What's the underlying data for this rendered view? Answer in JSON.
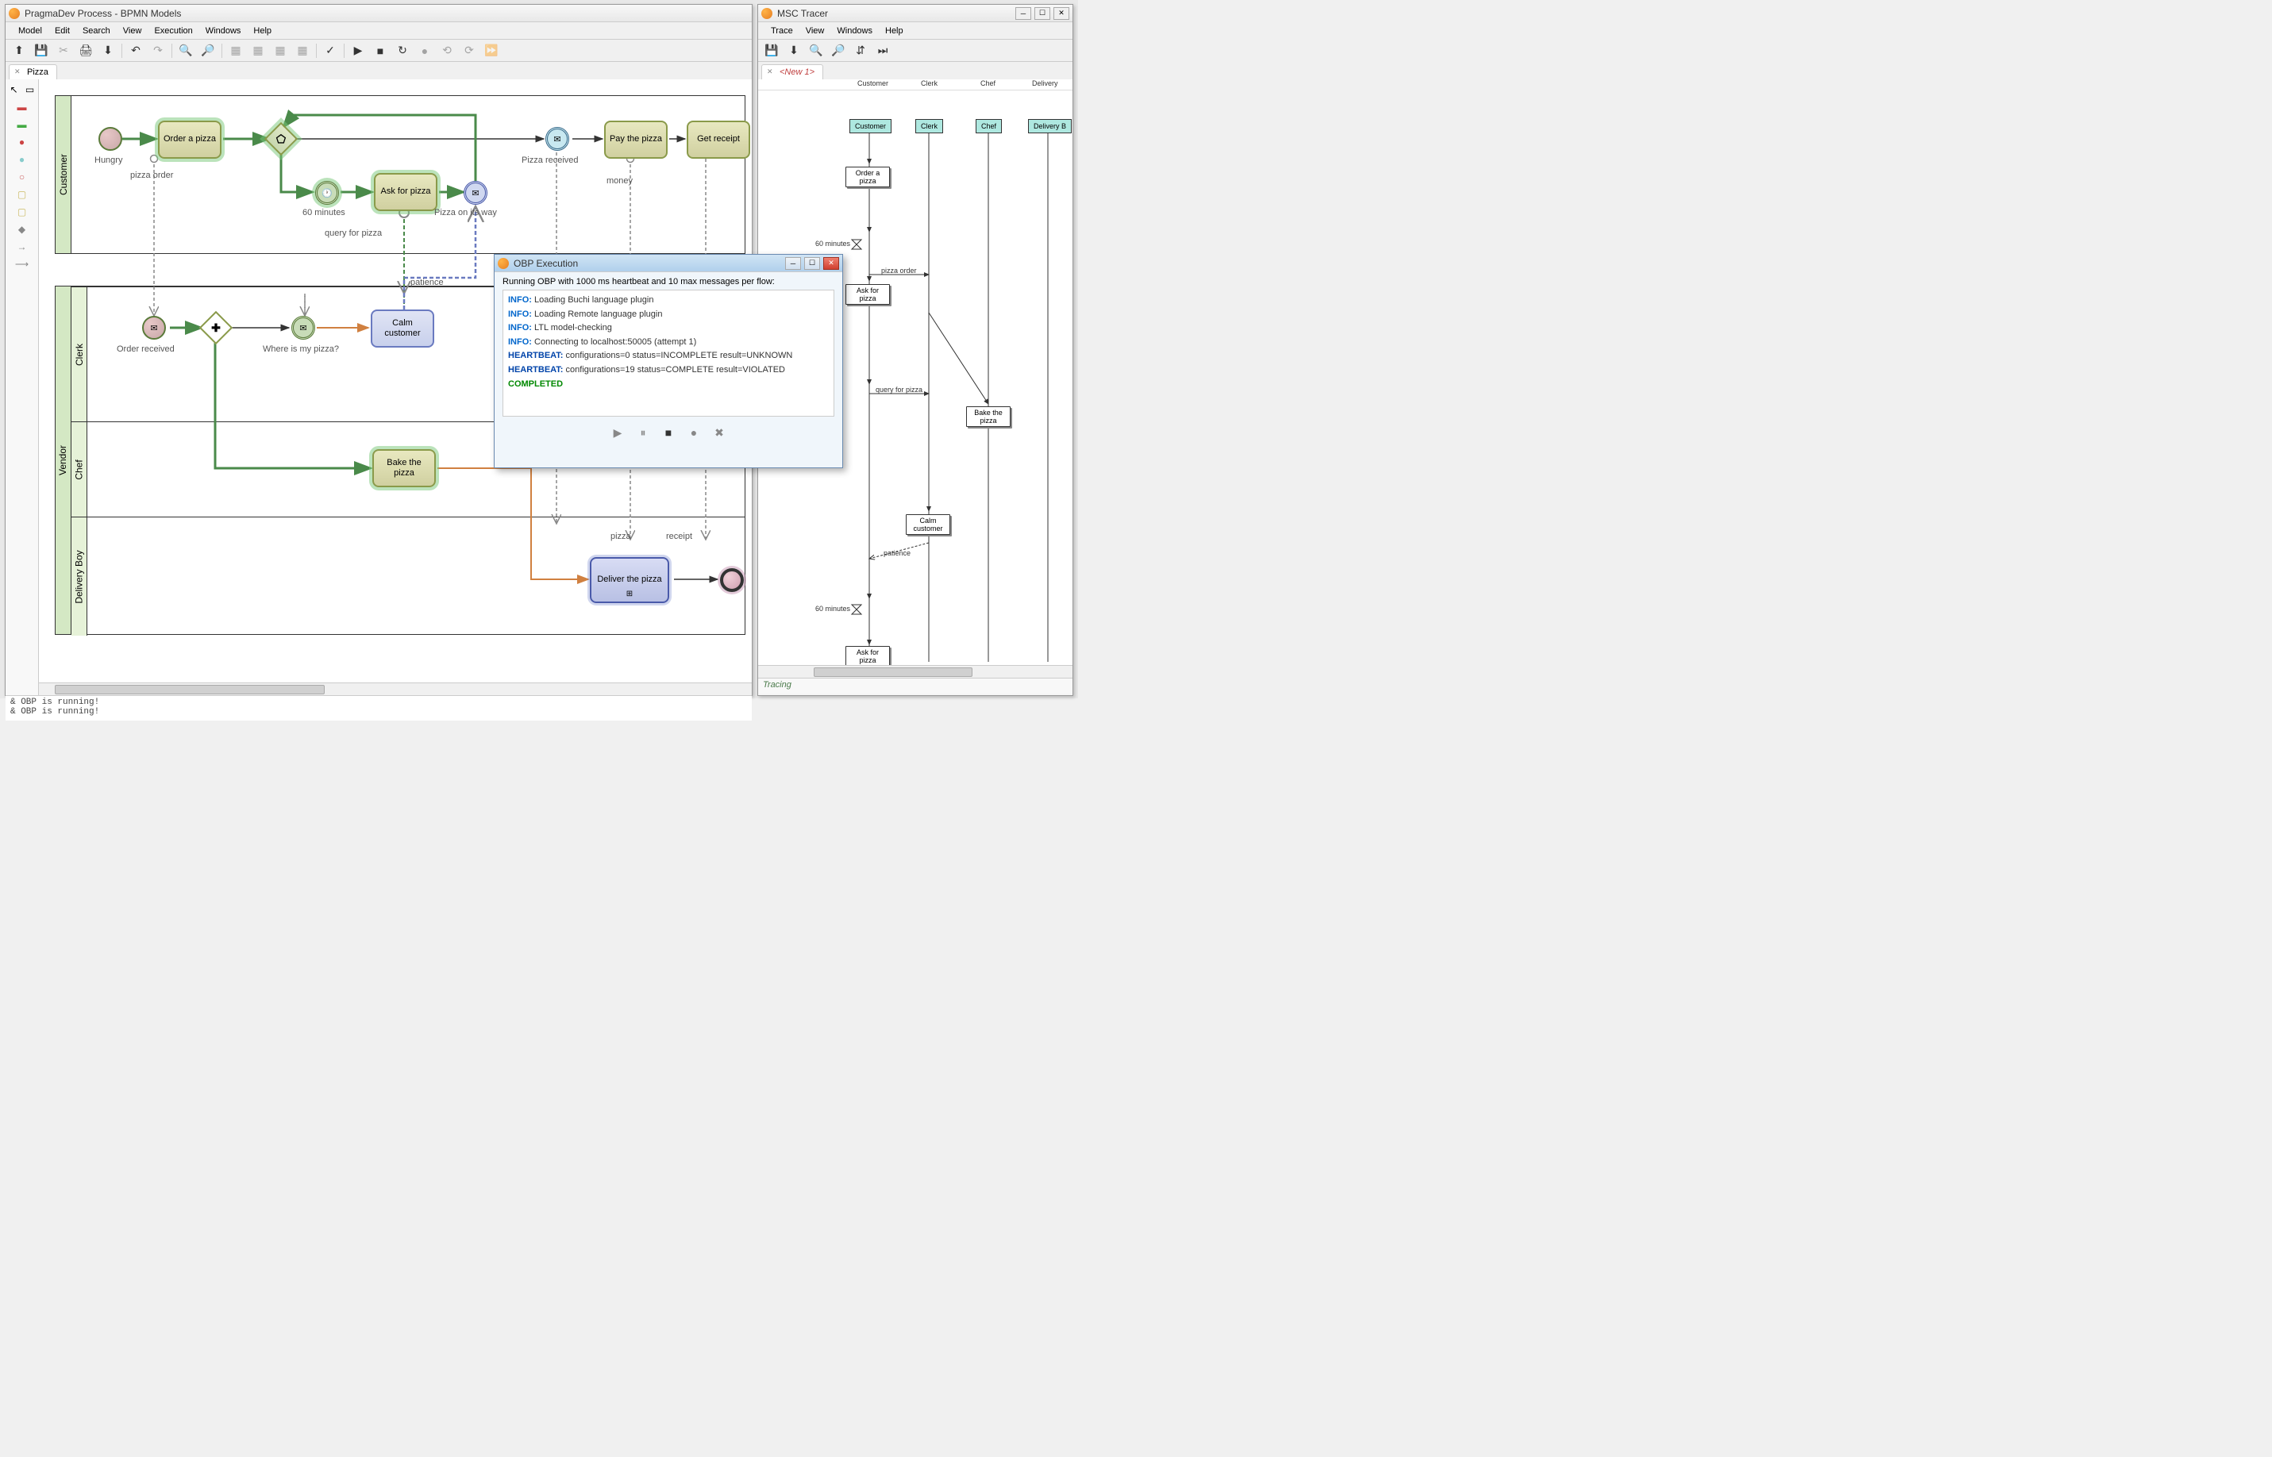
{
  "mainWindow": {
    "title": "PragmaDev Process - BPMN Models",
    "menu": [
      "Model",
      "Edit",
      "Search",
      "View",
      "Execution",
      "Windows",
      "Help"
    ],
    "tab": "Pizza",
    "console": [
      "& OBP is running!",
      "& OBP is running!"
    ]
  },
  "tracerWindow": {
    "title": "MSC Tracer",
    "menu": [
      "Trace",
      "View",
      "Windows",
      "Help"
    ],
    "tab": "<New 1>",
    "footer": "Tracing",
    "lifelines": [
      "Customer",
      "Clerk",
      "Chef",
      "Delivery B"
    ],
    "lifelinesTop": [
      "Customer",
      "Clerk",
      "Chef",
      "Delivery"
    ],
    "messages": {
      "order_a_pizza": "Order a pizza",
      "sixty_minutes": "60 minutes",
      "pizza_order": "pizza order",
      "ask_for_pizza": "Ask for pizza",
      "query_for_pizza": "query for pizza",
      "bake_the_pizza": "Bake the pizza",
      "calm_customer": "Calm customer",
      "patience": "patience",
      "sixty_minutes2": "60 minutes",
      "ask_for_pizza2": "Ask for pizza"
    }
  },
  "obpDialog": {
    "title": "OBP Execution",
    "running": "Running OBP with 1000 ms heartbeat and 10 max messages per flow:",
    "lines": [
      {
        "prefix": "INFO:",
        "text": " Loading Buchi language plugin",
        "cls": "info"
      },
      {
        "prefix": "INFO:",
        "text": " Loading Remote language plugin",
        "cls": "info"
      },
      {
        "prefix": "INFO:",
        "text": " LTL model-checking",
        "cls": "info"
      },
      {
        "prefix": "INFO:",
        "text": " Connecting to localhost:50005 (attempt 1)",
        "cls": "info"
      },
      {
        "prefix": "HEARTBEAT:",
        "text": " configurations=0 status=INCOMPLETE result=UNKNOWN",
        "cls": "hb"
      },
      {
        "prefix": "HEARTBEAT:",
        "text": " configurations=19 status=COMPLETE result=VIOLATED",
        "cls": "hb"
      },
      {
        "prefix": "COMPLETED",
        "text": "",
        "cls": "comp"
      }
    ]
  },
  "bpmn": {
    "pools": {
      "customer": "Customer",
      "vendor": "Vendor"
    },
    "lanes": {
      "clerk": "Clerk",
      "chef": "Chef",
      "delivery": "Delivery Boy"
    },
    "nodes": {
      "hungry": "Hungry",
      "order_pizza": "Order a pizza",
      "sixty_min": "60 minutes",
      "ask_for_pizza": "Ask for pizza",
      "pizza_on_way": "Pizza on its way",
      "pizza_received": "Pizza received",
      "pay_pizza": "Pay the pizza",
      "get_receipt": "Get receipt",
      "pizza_order": "pizza order",
      "query_for_pizza": "query for pizza",
      "patience": "patience",
      "money": "money",
      "pizza": "pizza",
      "receipt": "receipt",
      "order_received": "Order received",
      "where_pizza": "Where is my pizza?",
      "calm_customer": "Calm customer",
      "bake_pizza": "Bake the pizza",
      "deliver_pizza": "Deliver the pizza"
    }
  }
}
